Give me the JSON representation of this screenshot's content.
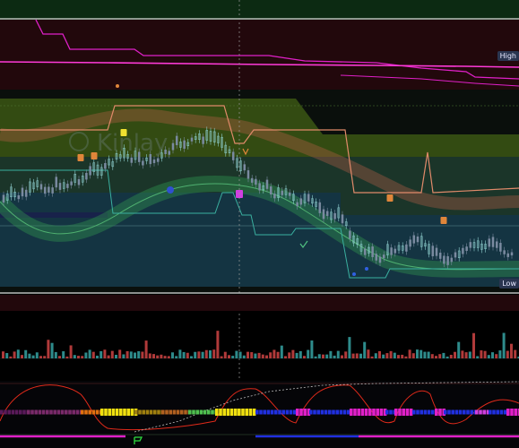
{
  "labels": {
    "high": "High",
    "low": "Low"
  },
  "watermark": "Kinlay",
  "colors": {
    "background": "#000000",
    "magenta": "#e020c8",
    "bull": "#2e8b8b",
    "bear": "#b03a3a",
    "band": "#2f8f4e",
    "cloud": "#3d5a14",
    "oscillator": "#e02a1a",
    "marker": "#e0863a"
  },
  "panels": [
    "price-panel",
    "volume-panel",
    "oscillator-panel"
  ]
}
